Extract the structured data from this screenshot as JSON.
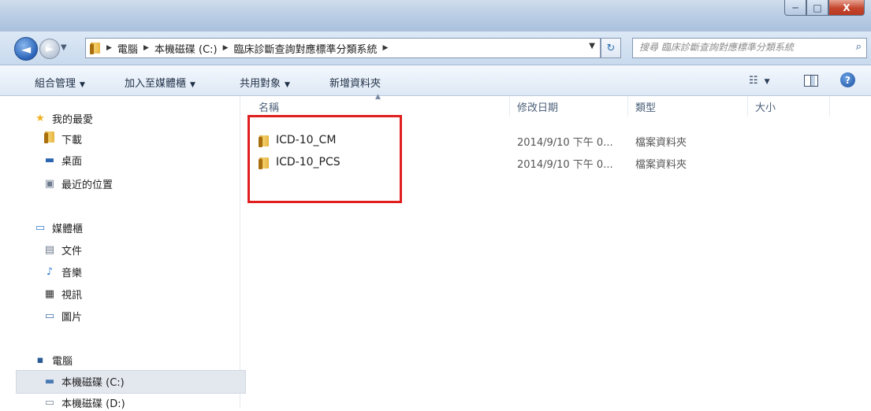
{
  "window": {
    "buttons": {
      "minimize": "─",
      "maximize": "□",
      "close": "X"
    }
  },
  "nav": {
    "back_glyph": "◄",
    "forward_glyph": "►",
    "breadcrumbs": [
      "電腦",
      "本機磁碟 (C:)",
      "臨床診斷查詢對應標準分類系統"
    ],
    "search_placeholder": "搜尋 臨床診斷查詢對應標準分類系統",
    "refresh_glyph": "↻",
    "search_glyph": "⌕"
  },
  "toolbar": {
    "organize": "組合管理",
    "include_library": "加入至媒體櫃",
    "share": "共用對象",
    "new_folder": "新增資料夾",
    "view_glyph": "☷",
    "help_glyph": "?"
  },
  "sidebar": {
    "favorites": {
      "label": "我的最愛",
      "items": [
        {
          "label": "下載",
          "icon": "download-folder-icon"
        },
        {
          "label": "桌面",
          "icon": "desktop-icon"
        },
        {
          "label": "最近的位置",
          "icon": "recent-places-icon"
        }
      ]
    },
    "libraries": {
      "label": "媒體櫃",
      "items": [
        {
          "label": "文件",
          "icon": "documents-icon"
        },
        {
          "label": "音樂",
          "icon": "music-icon"
        },
        {
          "label": "視訊",
          "icon": "video-icon"
        },
        {
          "label": "圖片",
          "icon": "pictures-icon"
        }
      ]
    },
    "computer": {
      "label": "電腦",
      "items": [
        {
          "label": "本機磁碟 (C:)",
          "icon": "drive-c-icon",
          "selected": true
        },
        {
          "label": "本機磁碟 (D:)",
          "icon": "drive-d-icon"
        }
      ]
    }
  },
  "file_list": {
    "columns": [
      "名稱",
      "修改日期",
      "類型",
      "大小"
    ],
    "rows": [
      {
        "name": "ICD-10_CM",
        "date": "2014/9/10 下午 0...",
        "type": "檔案資料夾",
        "size": ""
      },
      {
        "name": "ICD-10_PCS",
        "date": "2014/9/10 下午 0...",
        "type": "檔案資料夾",
        "size": ""
      }
    ]
  },
  "colors": {
    "highlight_box": "#e01f1f",
    "selected_bg": "#e3e7ee"
  }
}
